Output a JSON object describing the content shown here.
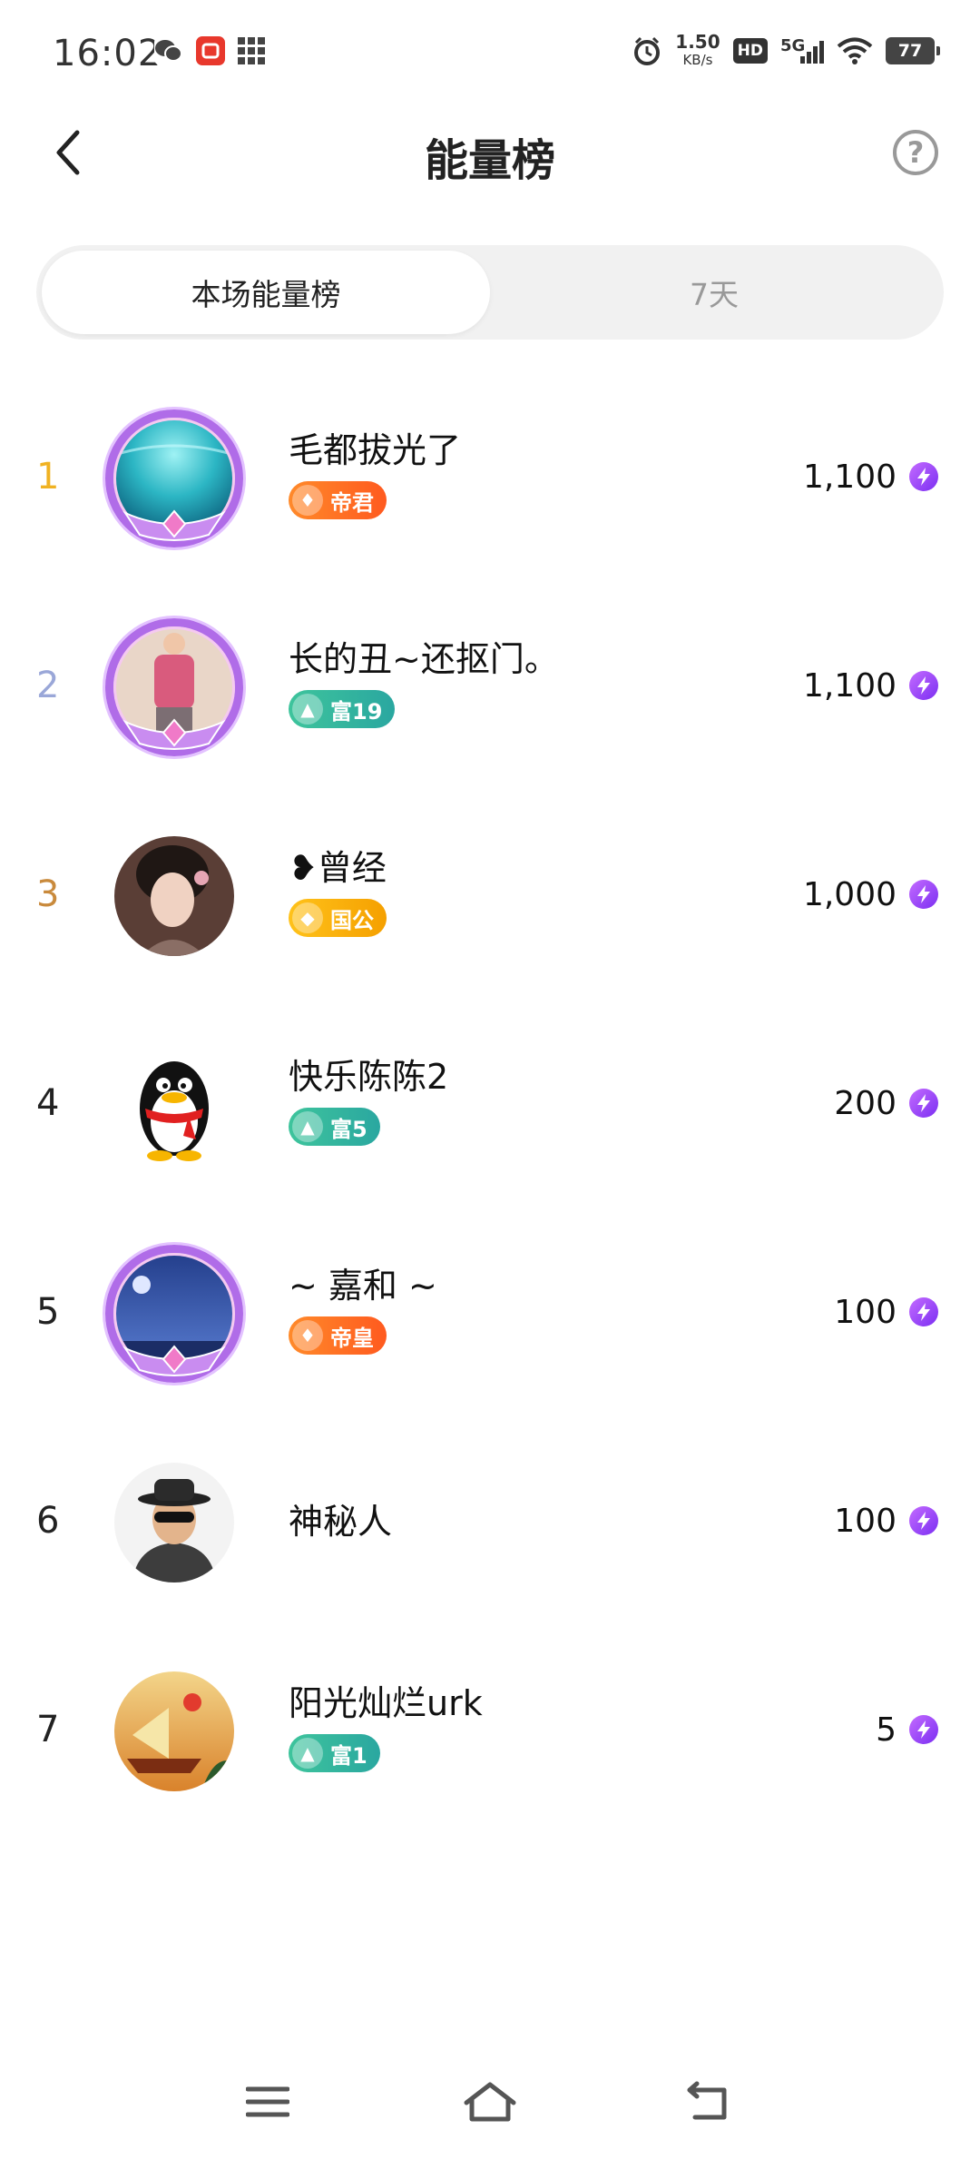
{
  "status_bar": {
    "time": "16:02",
    "net_speed_value": "1.50",
    "net_speed_unit": "KB/s",
    "hd_label": "HD",
    "network_label": "5G",
    "battery_level": "77"
  },
  "header": {
    "title": "能量榜",
    "back_icon": "chevron-left-icon",
    "help_label": "?"
  },
  "tabs": [
    {
      "label": "本场能量榜",
      "active": true
    },
    {
      "label": "7天",
      "active": false
    }
  ],
  "colors": {
    "rank1": "#f0b222",
    "rank2": "#9aa7d8",
    "rank3": "#c98a3c",
    "rank_default": "#222222",
    "bolt": "#8a3cf5"
  },
  "ranking": [
    {
      "rank": "1",
      "name": "毛都拔光了",
      "badge": "帝君",
      "badge_style": "orange",
      "score": "1,100",
      "frame": true,
      "avatar": "underwater"
    },
    {
      "rank": "2",
      "name": "长的丑~还抠门。",
      "badge": "富19",
      "badge_style": "teal",
      "score": "1,100",
      "frame": true,
      "avatar": "woman-pink"
    },
    {
      "rank": "3",
      "name": "❥曾经",
      "badge": "国公",
      "badge_style": "gold",
      "score": "1,000",
      "frame": false,
      "avatar": "portrait"
    },
    {
      "rank": "4",
      "name": "快乐陈陈2",
      "badge": "富5",
      "badge_style": "teal",
      "score": "200",
      "frame": false,
      "avatar": "penguin"
    },
    {
      "rank": "5",
      "name": "~ 嘉和 ~",
      "badge": "帝皇",
      "badge_style": "orange",
      "score": "100",
      "frame": true,
      "avatar": "night-sea"
    },
    {
      "rank": "6",
      "name": "神秘人",
      "badge": "",
      "badge_style": "",
      "score": "100",
      "frame": false,
      "avatar": "mystery"
    },
    {
      "rank": "7",
      "name": "阳光灿烂urk",
      "badge": "富1",
      "badge_style": "teal",
      "score": "5",
      "frame": false,
      "avatar": "sunset-boat"
    }
  ],
  "nav_bar": {
    "menu_icon": "menu-icon",
    "home_icon": "home-icon",
    "back_icon": "back-arrow-icon"
  }
}
